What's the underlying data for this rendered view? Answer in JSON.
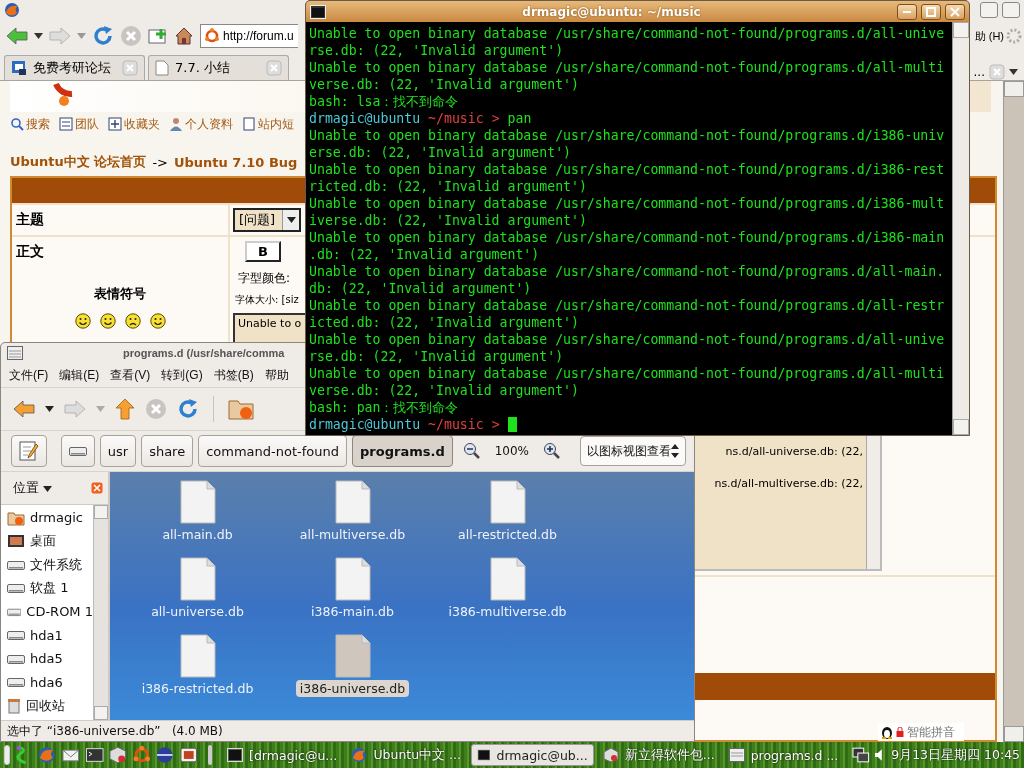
{
  "browser": {
    "url": "http://forum.u",
    "menu_fragment": "助 (H)",
    "tab_overflow": "...",
    "tabs": [
      {
        "label": "免费考研论坛",
        "selected": false
      },
      {
        "label": "7.7. 小结",
        "selected": false
      }
    ],
    "links": [
      "搜索",
      "团队",
      "收藏夹",
      "个人资料",
      "站内短"
    ],
    "breadcrumb": [
      {
        "kind": "link",
        "text": "Ubuntu中文 论坛首页"
      },
      {
        "kind": "separator",
        "text": "->"
      },
      {
        "kind": "link",
        "text": "Ubuntu 7.10 Bug"
      }
    ],
    "form": {
      "subject_label": "主题",
      "subject_value": "[问题]",
      "body_label": "正文",
      "emoticons_label": "表情符号",
      "bold_button": "B",
      "font_color_label": "字型颜色:",
      "font_size_label": "字体大小: [siz",
      "body_text_start": "Unable to o",
      "body_text_tail": [
        "ns.d/all-universe.db: (22,",
        "ns.d/all-multiverse.db: (22,"
      ]
    }
  },
  "terminal": {
    "title": "drmagic@ubuntu: ~/music",
    "lines": [
      {
        "kind": "output",
        "text": "Unable to open binary database /usr/share/command-not-found/programs.d/all-unive"
      },
      {
        "kind": "output",
        "text": "rse.db: (22, 'Invalid argument')"
      },
      {
        "kind": "output",
        "text": "Unable to open binary database /usr/share/command-not-found/programs.d/all-multi"
      },
      {
        "kind": "output",
        "text": "verse.db: (22, 'Invalid argument')"
      },
      {
        "kind": "output",
        "text": "bash: lsa：找不到命令"
      },
      {
        "kind": "prompt",
        "user_host": "drmagic@ubuntu",
        "path": "~/music >",
        "command": "pan",
        "cursor": false
      },
      {
        "kind": "output",
        "text": "Unable to open binary database /usr/share/command-not-found/programs.d/i386-univ"
      },
      {
        "kind": "output",
        "text": "erse.db: (22, 'Invalid argument')"
      },
      {
        "kind": "output",
        "text": "Unable to open binary database /usr/share/command-not-found/programs.d/i386-rest"
      },
      {
        "kind": "output",
        "text": "ricted.db: (22, 'Invalid argument')"
      },
      {
        "kind": "output",
        "text": "Unable to open binary database /usr/share/command-not-found/programs.d/i386-mult"
      },
      {
        "kind": "output",
        "text": "iverse.db: (22, 'Invalid argument')"
      },
      {
        "kind": "output",
        "text": "Unable to open binary database /usr/share/command-not-found/programs.d/i386-main"
      },
      {
        "kind": "output",
        "text": ".db: (22, 'Invalid argument')"
      },
      {
        "kind": "output",
        "text": "Unable to open binary database /usr/share/command-not-found/programs.d/all-main."
      },
      {
        "kind": "output",
        "text": "db: (22, 'Invalid argument')"
      },
      {
        "kind": "output",
        "text": "Unable to open binary database /usr/share/command-not-found/programs.d/all-restr"
      },
      {
        "kind": "output",
        "text": "icted.db: (22, 'Invalid argument')"
      },
      {
        "kind": "output",
        "text": "Unable to open binary database /usr/share/command-not-found/programs.d/all-unive"
      },
      {
        "kind": "output",
        "text": "rse.db: (22, 'Invalid argument')"
      },
      {
        "kind": "output",
        "text": "Unable to open binary database /usr/share/command-not-found/programs.d/all-multi"
      },
      {
        "kind": "output",
        "text": "verse.db: (22, 'Invalid argument')"
      },
      {
        "kind": "output",
        "text": "bash: pan：找不到命令"
      },
      {
        "kind": "prompt",
        "user_host": "drmagic@ubuntu",
        "path": "~/music >",
        "cursor": true
      }
    ]
  },
  "file_manager": {
    "title": "programs.d (/usr/share/comma",
    "menu": [
      "文件(F)",
      "编辑(E)",
      "查看(V)",
      "转到(G)",
      "书签(B)",
      "帮助"
    ],
    "path": [
      {
        "label": "usr",
        "selected": false
      },
      {
        "label": "share",
        "selected": false
      },
      {
        "label": "command-not-found",
        "selected": false
      },
      {
        "label": "programs.d",
        "selected": true
      }
    ],
    "zoom": "100%",
    "view_mode": "以图标视图查看",
    "sidebar": {
      "title": "位置",
      "items": [
        {
          "kind": "home",
          "label": "drmagic"
        },
        {
          "kind": "desktop",
          "label": "桌面"
        },
        {
          "kind": "drive",
          "label": "文件系统"
        },
        {
          "kind": "drive",
          "label": "软盘 1"
        },
        {
          "kind": "drive",
          "label": "CD-ROM 1"
        },
        {
          "kind": "drive",
          "label": "hda1"
        },
        {
          "kind": "drive",
          "label": "hda5"
        },
        {
          "kind": "drive",
          "label": "hda6"
        },
        {
          "kind": "trash",
          "label": "回收站"
        }
      ]
    },
    "files": [
      {
        "name": "all-main.db",
        "selected": false
      },
      {
        "name": "all-multiverse.db",
        "selected": false
      },
      {
        "name": "all-restricted.db",
        "selected": false
      },
      {
        "name": "all-universe.db",
        "selected": false
      },
      {
        "name": "i386-main.db",
        "selected": false
      },
      {
        "name": "i386-multiverse.db",
        "selected": false
      },
      {
        "name": "i386-restricted.db",
        "selected": false
      },
      {
        "name": "i386-universe.db",
        "selected": true
      }
    ],
    "status": "选中了 “i386-universe.db”   (4.0 MB)"
  },
  "input_method": {
    "label": "智能拼音"
  },
  "taskbar": {
    "tasks": [
      {
        "kind": "terminal",
        "label": "[drmagic@u...",
        "selected": false
      },
      {
        "kind": "browser",
        "label": "Ubuntu中文 ...",
        "selected": false
      },
      {
        "kind": "terminal",
        "label": "drmagic@ub...",
        "selected": true
      },
      {
        "kind": "package",
        "label": "新立得软件包...",
        "selected": false
      },
      {
        "kind": "folder",
        "label": "programs.d ...",
        "selected": false
      }
    ],
    "clock": "9月13日星期四 10:45"
  }
}
